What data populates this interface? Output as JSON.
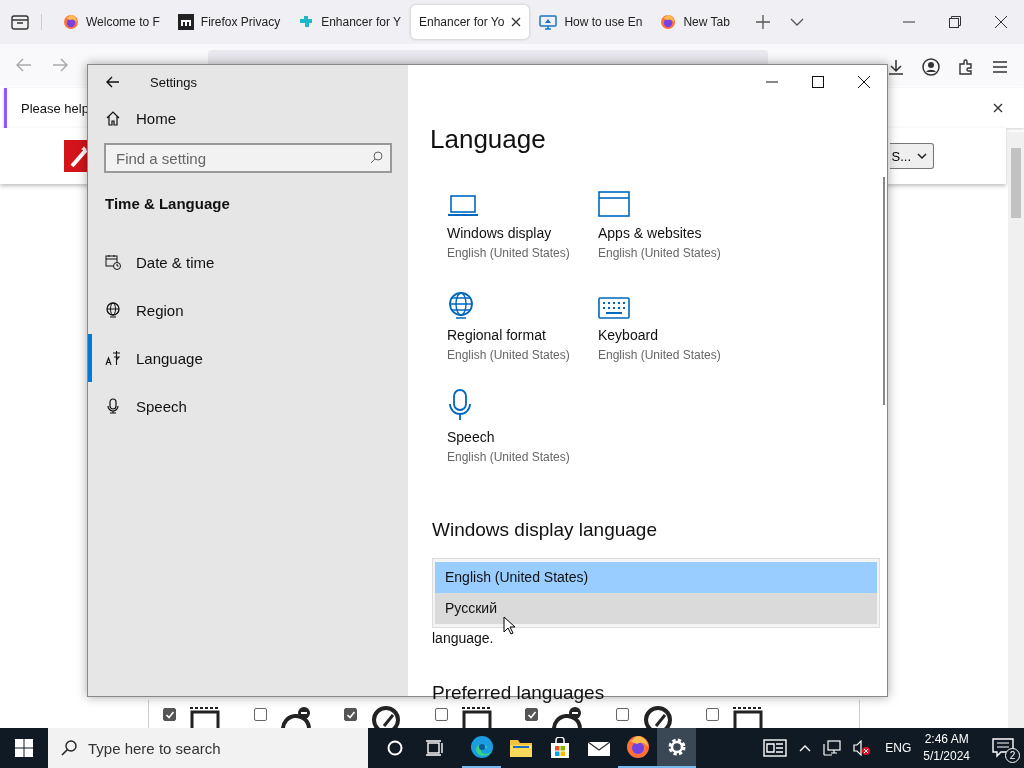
{
  "browser": {
    "tabs": [
      {
        "title": "Welcome to F",
        "selected": false
      },
      {
        "title": "Firefox Privacy",
        "selected": false
      },
      {
        "title": "Enhancer for Y",
        "selected": false
      },
      {
        "title": "Enhancer for Yo",
        "selected": true
      },
      {
        "title": "How to use En",
        "selected": false
      },
      {
        "title": "New Tab",
        "selected": false
      }
    ],
    "notification": {
      "text": "Please help"
    },
    "page": {
      "select_text": "S...",
      "options": [
        {
          "checked": true
        },
        {
          "checked": false
        },
        {
          "checked": true
        },
        {
          "checked": false
        },
        {
          "checked": true
        },
        {
          "checked": false
        },
        {
          "checked": false
        }
      ]
    }
  },
  "settings": {
    "title": "Settings",
    "home": "Home",
    "search": {
      "placeholder": "Find a setting"
    },
    "section": "Time & Language",
    "nav": [
      {
        "label": "Date & time",
        "selected": false
      },
      {
        "label": "Region",
        "selected": false
      },
      {
        "label": "Language",
        "selected": true
      },
      {
        "label": "Speech",
        "selected": false
      }
    ],
    "heading": "Language",
    "tiles": [
      {
        "title": "Windows display",
        "subtitle": "English (United States)"
      },
      {
        "title": "Apps & websites",
        "subtitle": "English (United States)"
      },
      {
        "title": "Regional format",
        "subtitle": "English (United States)"
      },
      {
        "title": "Keyboard",
        "subtitle": "English (United States)"
      },
      {
        "title": "Speech",
        "subtitle": "English (United States)"
      }
    ],
    "display_language": {
      "heading": "Windows display language",
      "options": [
        {
          "label": "English (United States)",
          "selected": true,
          "hovered": false
        },
        {
          "label": "Русский",
          "selected": false,
          "hovered": true
        }
      ],
      "note": "language."
    },
    "preferred_heading": "Preferred languages"
  },
  "taskbar": {
    "search_placeholder": "Type here to search",
    "language": "ENG",
    "time": "2:46 AM",
    "date": "5/1/2024",
    "notifications": "2"
  }
}
